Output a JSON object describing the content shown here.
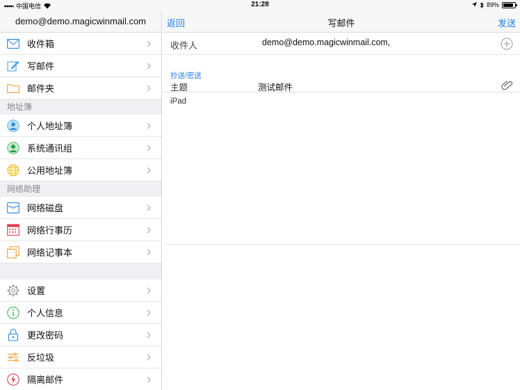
{
  "status": {
    "carrier": "中国电信",
    "time": "21:28",
    "battery_text": "89%",
    "battery_level": 0.89
  },
  "sidebar": {
    "account": "demo@demo.magicwinmail.com",
    "mail_items": [
      {
        "label": "收件箱",
        "icon": "inbox-icon"
      },
      {
        "label": "写邮件",
        "icon": "compose-icon"
      },
      {
        "label": "邮件夹",
        "icon": "folder-icon"
      }
    ],
    "section_contacts": "地址簿",
    "contact_items": [
      {
        "label": "个人地址簿",
        "icon": "person-icon"
      },
      {
        "label": "系统通讯组",
        "icon": "group-icon"
      },
      {
        "label": "公用地址簿",
        "icon": "globe-icon"
      }
    ],
    "section_tools": "网络助理",
    "tool_items": [
      {
        "label": "网络磁盘",
        "icon": "disk-icon"
      },
      {
        "label": "网络行事历",
        "icon": "calendar-icon"
      },
      {
        "label": "网络记事本",
        "icon": "notes-icon"
      }
    ],
    "settings_items": [
      {
        "label": "设置",
        "icon": "gear-icon"
      },
      {
        "label": "个人信息",
        "icon": "info-icon"
      },
      {
        "label": "更改密码",
        "icon": "lock-icon"
      },
      {
        "label": "反垃圾",
        "icon": "filter-icon"
      },
      {
        "label": "隔离邮件",
        "icon": "quarantine-icon"
      }
    ]
  },
  "compose": {
    "back_label": "返回",
    "title": "写邮件",
    "send_label": "发送",
    "to_label": "收件人",
    "to_value": "demo@demo.magicwinmail.com,",
    "cc_label": "抄送/密送",
    "subject_label": "主题",
    "subject_value": "测试邮件",
    "body_text": "iPad"
  },
  "colors": {
    "accent": "#1a7ef2",
    "section_bg": "#efeff4",
    "separator": "#e6e6e6"
  }
}
